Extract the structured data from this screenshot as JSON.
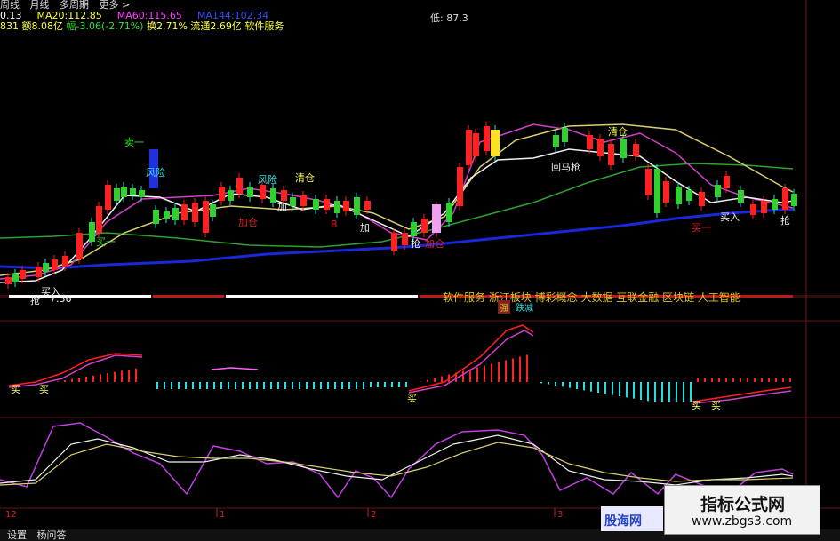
{
  "toolbar": {
    "items": [
      "周线",
      "月线",
      "多周期",
      "更多 >"
    ]
  },
  "ma": {
    "ma10": "0.13",
    "ma20_label": "MA20:",
    "ma20": "112.85",
    "ma60_label": "MA60:",
    "ma60": "115.65",
    "ma144_label": "MA144:",
    "ma144": "102.34"
  },
  "info": {
    "vol": "831",
    "amount": "额8.08亿",
    "change": "幅-3.06(-2.71%)",
    "turnover": "换2.71%",
    "float": "流通2.69亿",
    "sector": "软件服务"
  },
  "low_label": "低: 87.3",
  "concepts": "软件服务 浙江板块 博彩概念 大数据 互联金融 区块链 人工智能",
  "chart_signals": {
    "sell1": "卖一",
    "risk1": "风险",
    "risk2": "风险",
    "clear1": "清仓",
    "clear2": "清仓",
    "add1": "加仓",
    "add2": "加仓",
    "add3": "加",
    "add4": "加",
    "buy_in1": "买入",
    "buy_in2": "买入",
    "buy1": "买一",
    "buy2": "买一",
    "grab1": "抢",
    "grab2": "抢",
    "grab3": "抢",
    "horse": "回马枪",
    "lowpoint": "7.36",
    "strong": "强",
    "buy_mark": "买",
    "sell_b": "B",
    "down_mark": "跌减"
  },
  "macd_labels": [
    "买",
    "买",
    "买",
    "买",
    "买"
  ],
  "bottom": {
    "ticks": [
      "12",
      "1",
      "2",
      "3"
    ],
    "btn1": "设置",
    "btn2": "杨问答"
  },
  "watermark": {
    "line1": "指标公式网",
    "line2": "www.zbgs3.com",
    "logo": "股海网"
  },
  "colors": {
    "up": "#ff2020",
    "down": "#20e0e0",
    "ma_blue": "#1a28d8",
    "ma_white": "#f0f0f0",
    "ma_yellow": "#d8d070",
    "ma_magenta": "#d040c8",
    "ma_green": "#30a030"
  }
}
